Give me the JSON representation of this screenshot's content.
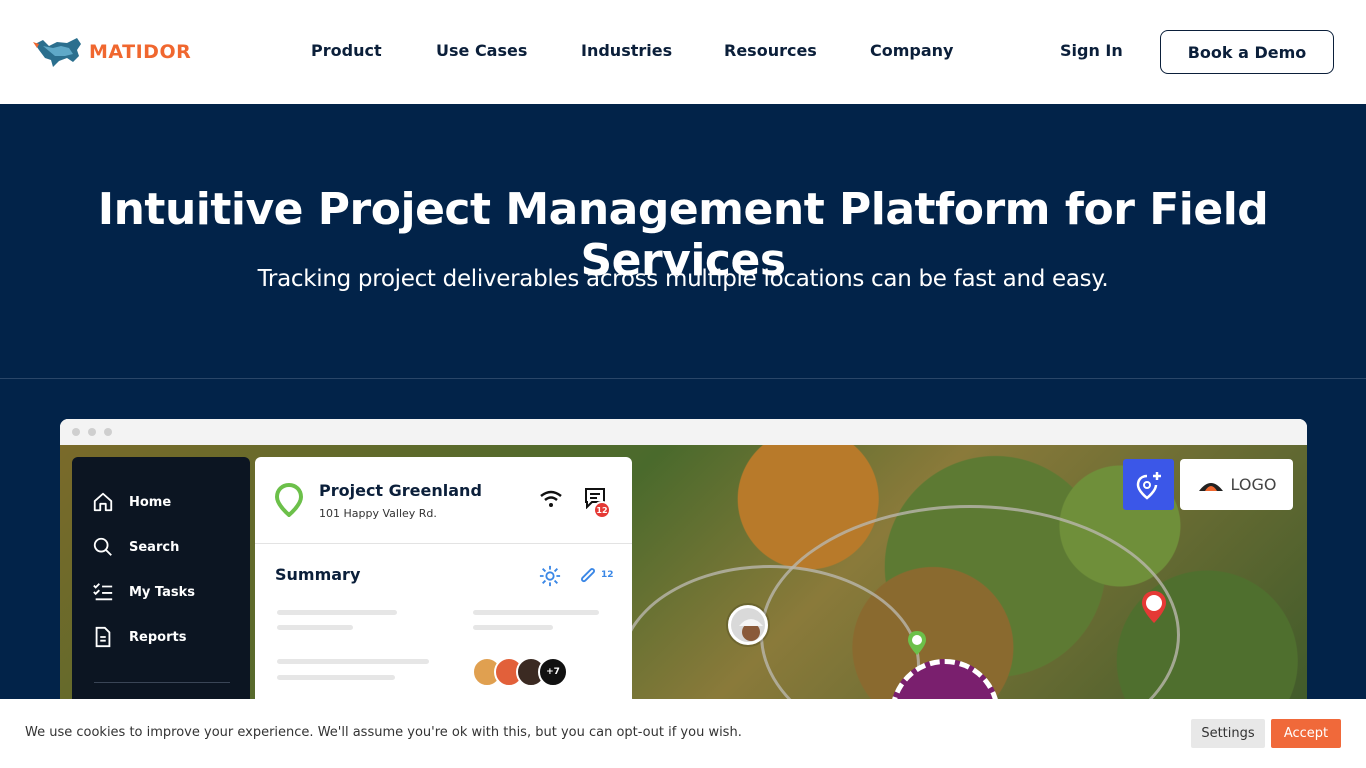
{
  "header": {
    "logo_text": "MATIDOR",
    "nav": [
      "Product",
      "Use Cases",
      "Industries",
      "Resources",
      "Company"
    ],
    "signin_label": "Sign In",
    "demo_label": "Book a Demo"
  },
  "hero": {
    "title": "Intuitive Project Management Platform for Field Services",
    "subtitle": "Tracking project deliverables across multiple locations can be fast and easy."
  },
  "app": {
    "sidebar": [
      "Home",
      "Search",
      "My Tasks",
      "Reports"
    ],
    "project_title": "Project Greenland",
    "project_address": "101 Happy Valley Rd.",
    "message_badge": "12",
    "summary_label": "Summary",
    "attachment_count": "12",
    "avatar_more": "+7",
    "logo_card_text": "LOGO"
  },
  "cookie": {
    "text": "We use cookies to improve your experience. We'll assume you're ok with this, but you can opt-out if you wish.",
    "settings_label": "Settings",
    "accept_label": "Accept"
  },
  "colors": {
    "brand_orange": "#f0672f",
    "hero_bg": "#022349",
    "accent_blue": "#3b57e8"
  }
}
